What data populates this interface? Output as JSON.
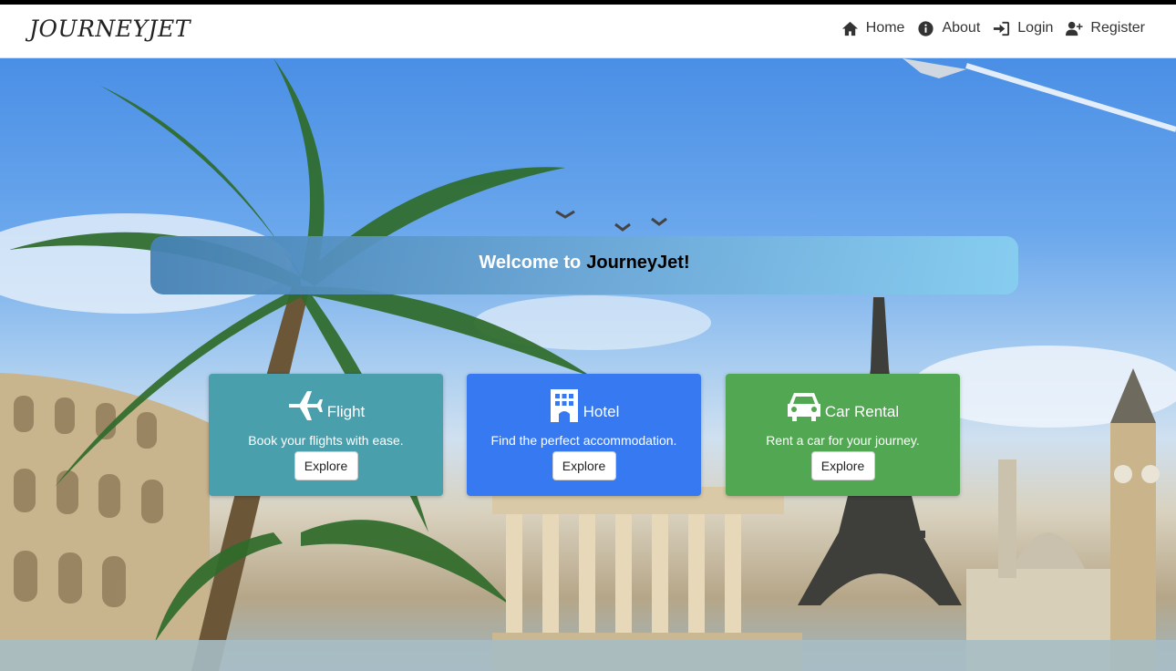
{
  "brand": "JOURNEYJET",
  "nav": [
    {
      "label": "Home",
      "icon": "home-icon"
    },
    {
      "label": "About",
      "icon": "info-icon"
    },
    {
      "label": "Login",
      "icon": "login-icon"
    },
    {
      "label": "Register",
      "icon": "user-plus-icon"
    }
  ],
  "welcome": {
    "prefix": "Welcome to",
    "name": "JourneyJet!"
  },
  "cards": [
    {
      "title": "Flight",
      "text": "Book your flights with ease.",
      "button": "Explore",
      "icon": "plane-icon",
      "color": "#4a9fad"
    },
    {
      "title": "Hotel",
      "text": "Find the perfect accommodation.",
      "button": "Explore",
      "icon": "hotel-icon",
      "color": "#3679f0"
    },
    {
      "title": "Car Rental",
      "text": "Rent a car for your journey.",
      "button": "Explore",
      "icon": "car-icon",
      "color": "#52a852"
    }
  ]
}
